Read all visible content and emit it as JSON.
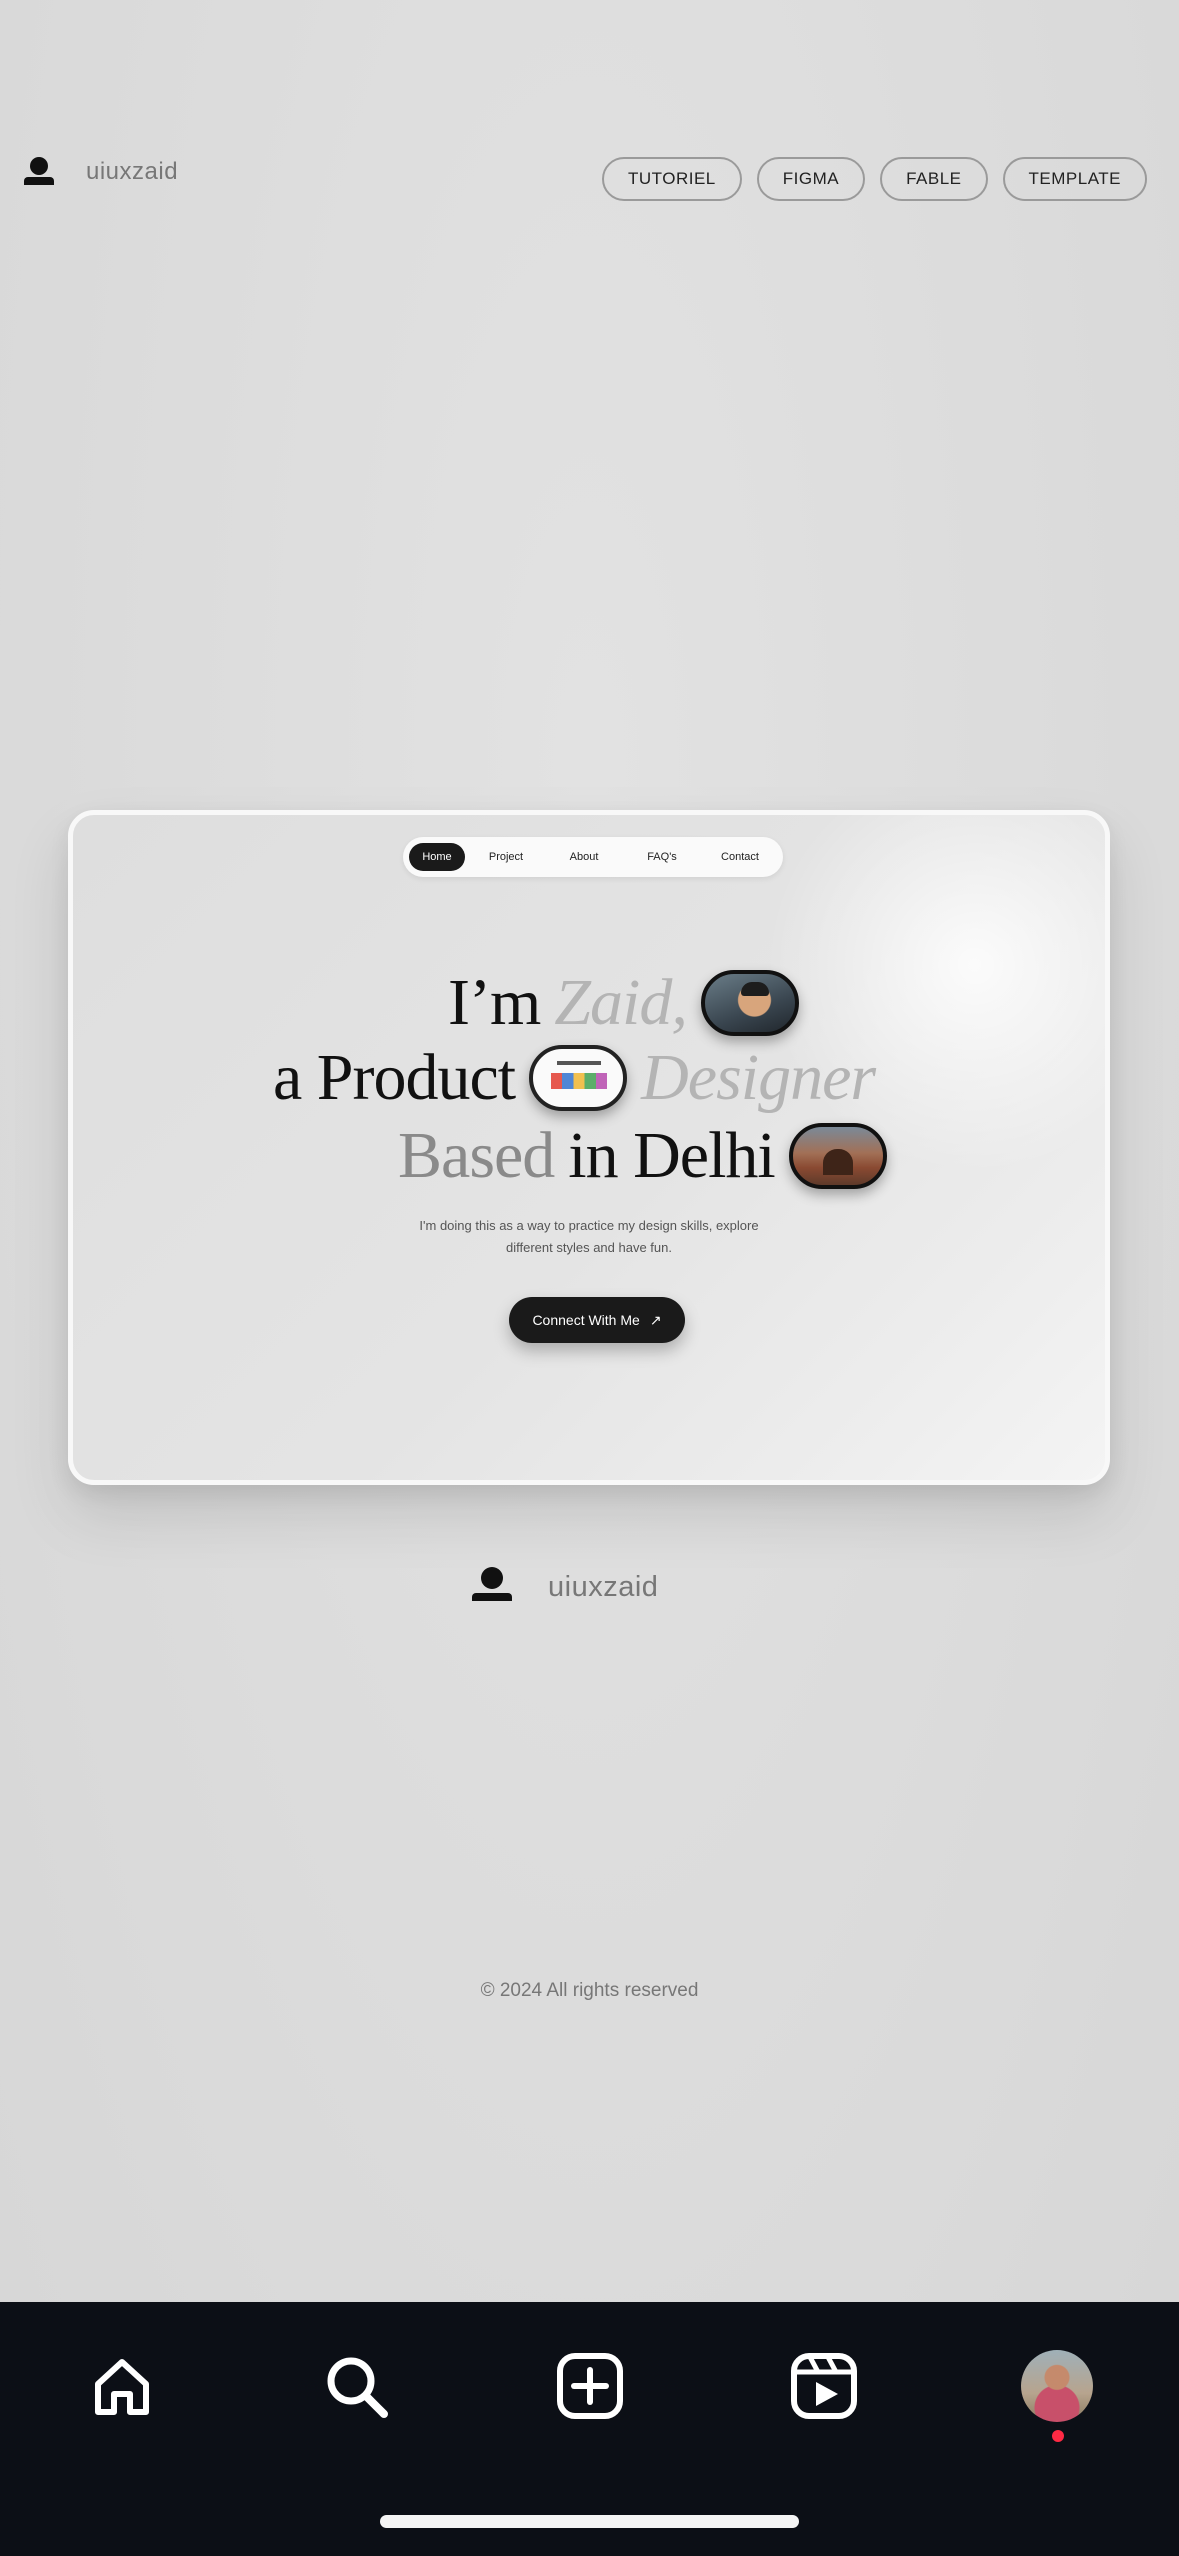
{
  "header": {
    "brand": "uiuxzaid",
    "nav": [
      "TUTORIEL",
      "FIGMA",
      "FABLE",
      "TEMPLATE"
    ]
  },
  "card": {
    "nav": [
      "Home",
      "Project",
      "About",
      "FAQ's",
      "Contact"
    ],
    "hero": {
      "line1_a": "I’m",
      "line1_b": "Zaid,",
      "line2_a": "a Product",
      "line2_b": "Designer",
      "line3_a": "Based",
      "line3_b": "in Delhi"
    },
    "subtitle_1": "I'm doing this as a way to practice my design skills, explore",
    "subtitle_2": "different styles and have fun.",
    "cta": "Connect With Me",
    "cta_icon": "↗"
  },
  "footer": {
    "brand": "uiuxzaid",
    "copyright": "© 2024 All rights reserved"
  },
  "tabbar": {
    "icons": [
      "home-icon",
      "search-icon",
      "create-icon",
      "reels-icon",
      "profile-avatar"
    ],
    "notification_color": "#ff2a44"
  }
}
